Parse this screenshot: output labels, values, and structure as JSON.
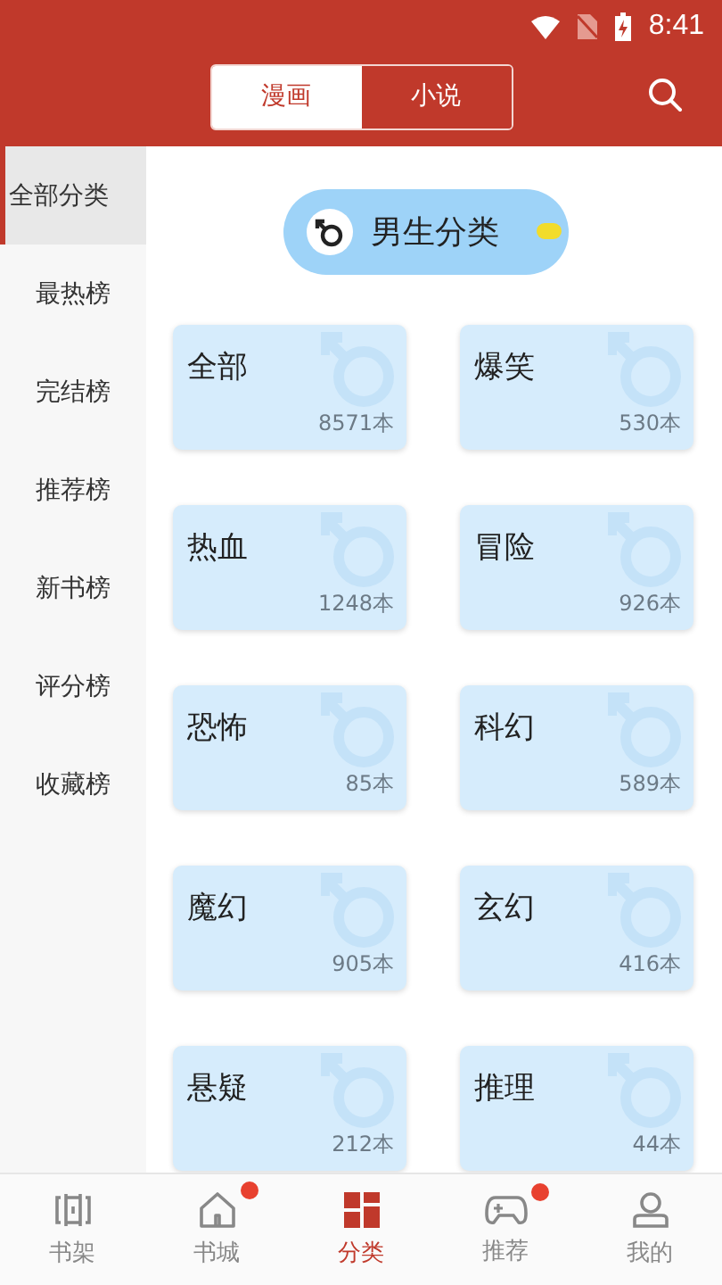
{
  "status_bar": {
    "time": "8:41"
  },
  "tabs": [
    {
      "label": "漫画",
      "selected": true
    },
    {
      "label": "小说",
      "selected": false
    }
  ],
  "sidebar": {
    "items": [
      {
        "label": "全部分类",
        "selected": true
      },
      {
        "label": "最热榜",
        "selected": false
      },
      {
        "label": "完结榜",
        "selected": false
      },
      {
        "label": "推荐榜",
        "selected": false
      },
      {
        "label": "新书榜",
        "selected": false
      },
      {
        "label": "评分榜",
        "selected": false
      },
      {
        "label": "收藏榜",
        "selected": false
      }
    ]
  },
  "section": {
    "title": "男生分类"
  },
  "categories": [
    {
      "name": "全部",
      "count": "8571本"
    },
    {
      "name": "爆笑",
      "count": "530本"
    },
    {
      "name": "热血",
      "count": "1248本"
    },
    {
      "name": "冒险",
      "count": "926本"
    },
    {
      "name": "恐怖",
      "count": "85本"
    },
    {
      "name": "科幻",
      "count": "589本"
    },
    {
      "name": "魔幻",
      "count": "905本"
    },
    {
      "name": "玄幻",
      "count": "416本"
    },
    {
      "name": "悬疑",
      "count": "212本"
    },
    {
      "name": "推理",
      "count": "44本"
    }
  ],
  "bottom_nav": [
    {
      "kind": "shelf",
      "label": "书架",
      "selected": false,
      "badge": false
    },
    {
      "kind": "home",
      "label": "书城",
      "selected": false,
      "badge": true
    },
    {
      "kind": "grid",
      "label": "分类",
      "selected": true,
      "badge": false
    },
    {
      "kind": "game",
      "label": "推荐",
      "selected": false,
      "badge": true
    },
    {
      "kind": "user",
      "label": "我的",
      "selected": false,
      "badge": false
    }
  ]
}
